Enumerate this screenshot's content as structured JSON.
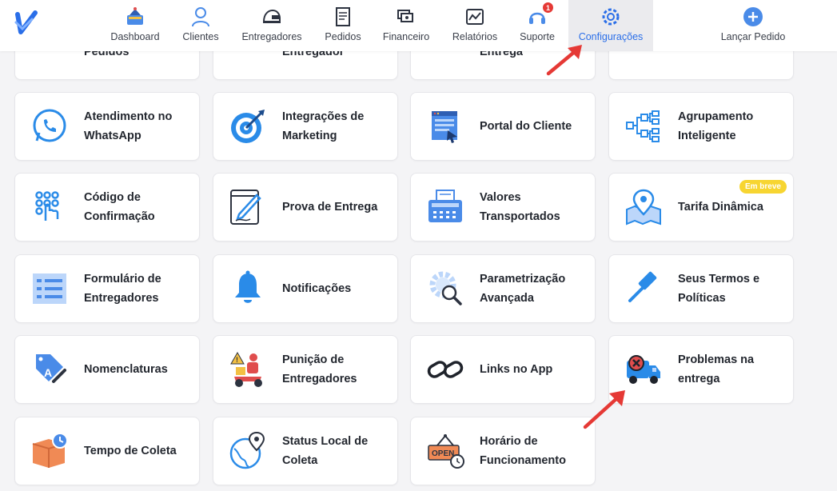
{
  "nav": {
    "items": [
      {
        "label": "Dashboard",
        "icon": "dashboard-icon"
      },
      {
        "label": "Clientes",
        "icon": "user-icon"
      },
      {
        "label": "Entregadores",
        "icon": "helmet-icon"
      },
      {
        "label": "Pedidos",
        "icon": "receipt-icon"
      },
      {
        "label": "Financeiro",
        "icon": "money-icon"
      },
      {
        "label": "Relatórios",
        "icon": "report-icon"
      },
      {
        "label": "Suporte",
        "icon": "headset-icon",
        "badge": "1"
      },
      {
        "label": "Configurações",
        "icon": "gear-icon",
        "active": true
      },
      {
        "label": "Lançar Pedido",
        "icon": "plus-circle-icon"
      }
    ]
  },
  "cards": {
    "partial": [
      "Pedidos",
      "Entregador",
      "Entrega",
      ""
    ],
    "row1": [
      "Atendimento no WhatsApp",
      "Integrações de Marketing",
      "Portal do Cliente",
      "Agrupamento Inteligente"
    ],
    "row2": [
      "Código de Confirmação",
      "Prova de Entrega",
      "Valores Transportados",
      "Tarifa Dinâmica"
    ],
    "row3": [
      "Formulário de Entregadores",
      "Notificações",
      "Parametrização Avançada",
      "Seus Termos e Políticas"
    ],
    "row4": [
      "Nomenclaturas",
      "Punição de Entregadores",
      "Links no App",
      "Problemas na entrega"
    ],
    "row5": [
      "Tempo de Coleta",
      "Status Local de Coleta",
      "Horário de Funcionamento"
    ]
  },
  "soon_badge": "Em breve",
  "colors": {
    "accent": "#2a6ee8",
    "arrow": "#e53935",
    "badge": "#f7d531"
  }
}
